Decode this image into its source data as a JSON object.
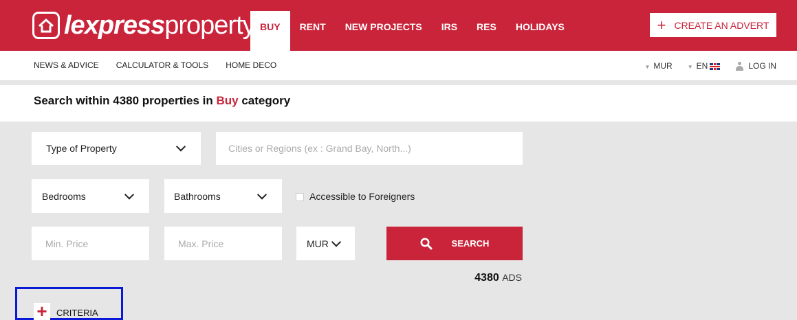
{
  "brand": {
    "logo_bold": "lexpress",
    "logo_light": "property"
  },
  "nav": {
    "items": [
      "BUY",
      "RENT",
      "NEW PROJECTS",
      "IRS",
      "RES",
      "HOLIDAYS"
    ],
    "active": "BUY"
  },
  "create_advert": {
    "plus": "+",
    "label": "CREATE AN ADVERT"
  },
  "subnav": {
    "left": [
      "NEWS & ADVICE",
      "CALCULATOR & TOOLS",
      "HOME DECO"
    ],
    "currency": "MUR",
    "language": "EN",
    "login": "LOG IN"
  },
  "headline": {
    "prefix": "Search within 4380 properties in ",
    "category": "Buy",
    "suffix": " category"
  },
  "form": {
    "type_of_property": "Type of Property",
    "location_placeholder": "Cities or Regions (ex : Grand Bay, North...)",
    "bedrooms": "Bedrooms",
    "bathrooms": "Bathrooms",
    "accessible_label": "Accessible to Foreigners",
    "min_price_placeholder": "Min. Price",
    "max_price_placeholder": "Max. Price",
    "currency": "MUR",
    "search_label": "SEARCH"
  },
  "results": {
    "count": "4380",
    "unit": "ADS"
  },
  "criteria": {
    "plus": "+",
    "label": "CRITERIA"
  },
  "colors": {
    "brand_red": "#c9243a",
    "highlight_blue": "#0a18d8"
  }
}
